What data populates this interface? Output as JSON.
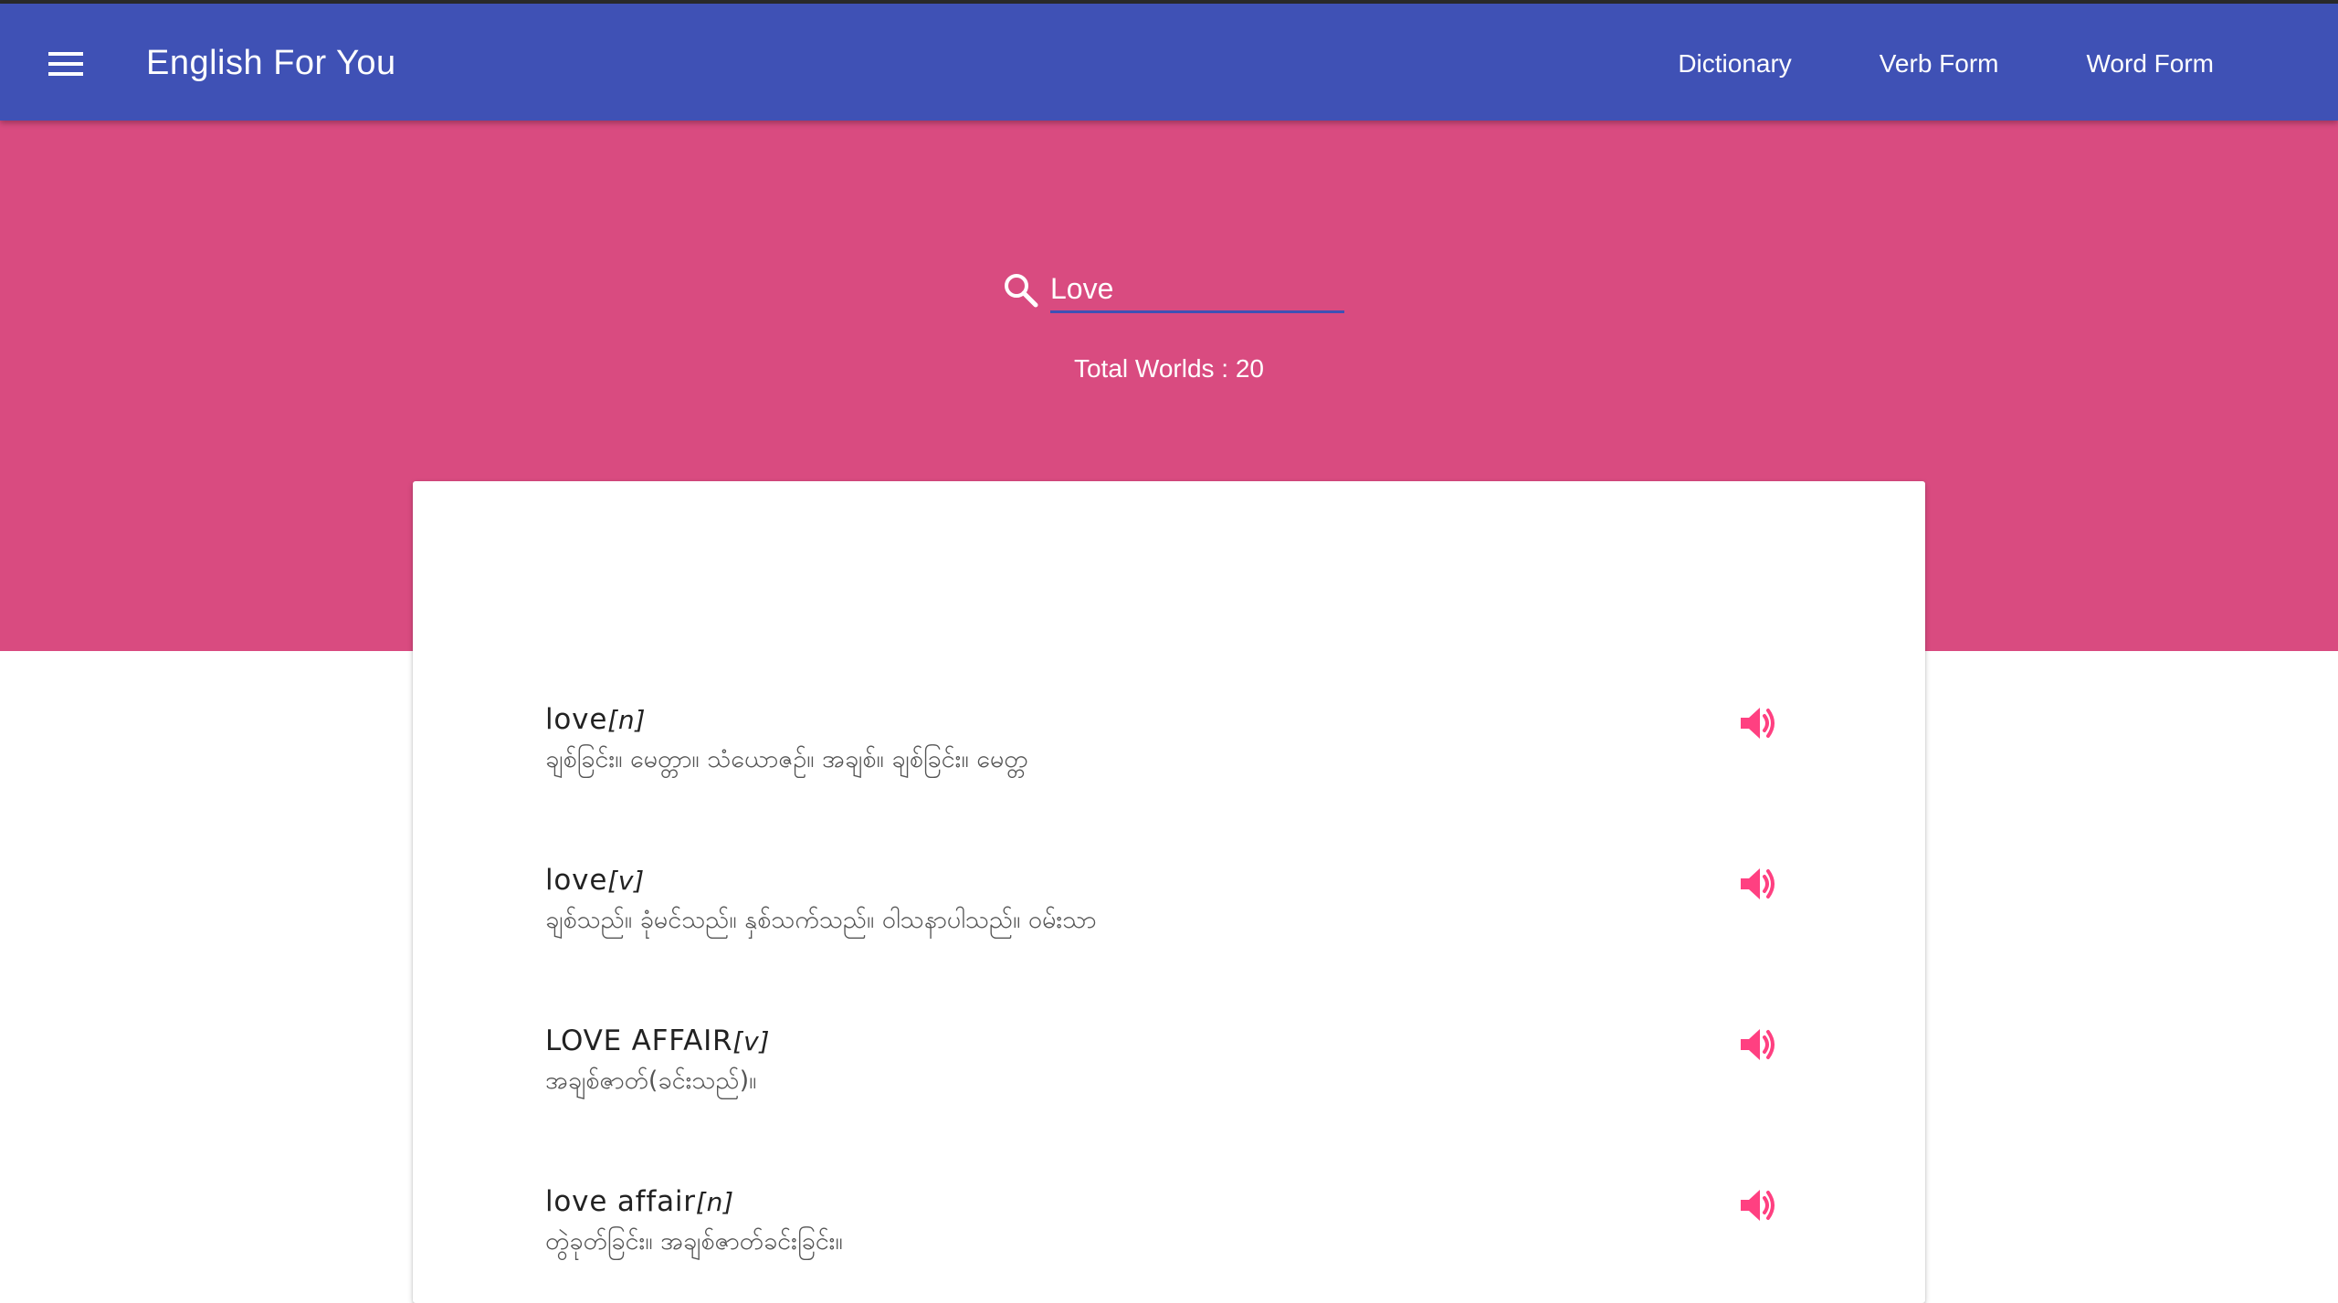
{
  "app": {
    "title": "English For You"
  },
  "nav": {
    "items": [
      {
        "label": "Dictionary"
      },
      {
        "label": "Verb Form"
      },
      {
        "label": "Word Form"
      }
    ]
  },
  "search": {
    "value": "Love",
    "placeholder": ""
  },
  "summary": {
    "total_text": "Total Worlds : 20"
  },
  "entries": [
    {
      "word": "love",
      "pos": "[n]",
      "meaning": "ချစ်ခြင်း။ မေတ္တာ။ သံယောဇဉ်။ အချစ်။ ချစ်ခြင်း။ မေတ္တ"
    },
    {
      "word": "love",
      "pos": "[v]",
      "meaning": "ချစ်သည်။ ခုံမင်သည်။ နှစ်သက်သည်။ ဝါသနာပါသည်။ ဝမ်းသာ"
    },
    {
      "word": "LOVE AFFAIR",
      "pos": "[v]",
      "meaning": "အချစ်ဇာတ်(ခင်းသည်)။"
    },
    {
      "word": "love affair",
      "pos": "[n]",
      "meaning": "တွဲခုတ်ခြင်း။ အချစ်ဇာတ်ခင်းခြင်း။"
    }
  ],
  "colors": {
    "appbar": "#3f51b5",
    "hero": "#d94b80",
    "accent": "#ff4081",
    "card": "#ffffff"
  },
  "icons": {
    "menu": "menu-icon",
    "search": "search-icon",
    "speaker": "volume-icon"
  }
}
